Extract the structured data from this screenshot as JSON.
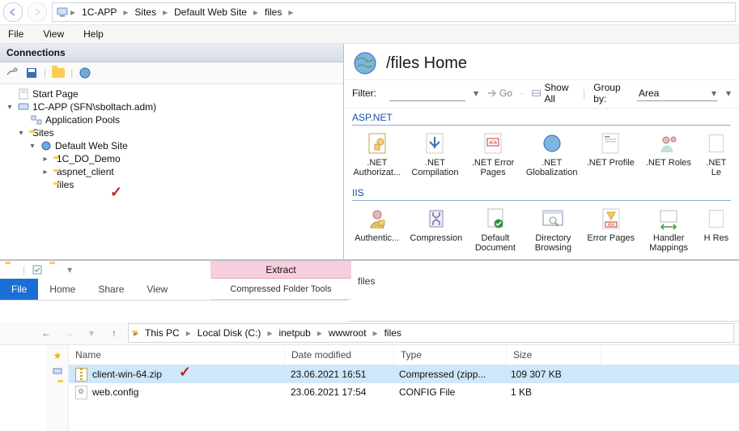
{
  "breadcrumb": {
    "root_icon": "server-icon",
    "items": [
      "1C-APP",
      "Sites",
      "Default Web Site",
      "files"
    ]
  },
  "menu": {
    "file": "File",
    "view": "View",
    "help": "Help"
  },
  "connections": {
    "title": "Connections",
    "tree": {
      "start_page": "Start Page",
      "server": "1C-APP (SFN\\sboltach.adm)",
      "app_pools": "Application Pools",
      "sites": "Sites",
      "default_site": "Default Web Site",
      "site_children": [
        "1C_DO_Demo",
        "aspnet_client",
        "files"
      ]
    }
  },
  "home": {
    "title": "/files Home",
    "filter_label": "Filter:",
    "go": "Go",
    "show_all": "Show All",
    "group_by": "Group by:",
    "group_value": "Area",
    "groups": {
      "aspnet": "ASP.NET",
      "iis": "IIS"
    },
    "aspnet_features": [
      ".NET Authorizat...",
      ".NET Compilation",
      ".NET Error Pages",
      ".NET Globalization",
      ".NET Profile",
      ".NET Roles",
      ".NET Le"
    ],
    "iis_features": [
      "Authentic...",
      "Compression",
      "Default Document",
      "Directory Browsing",
      "Error Pages",
      "Handler Mappings",
      "H Res"
    ]
  },
  "explorer": {
    "ribbon_extract": "Extract",
    "ribbon_tools": "Compressed Folder Tools",
    "ribbon": {
      "file": "File",
      "home": "Home",
      "share": "Share",
      "view": "View"
    },
    "addr_label": "files",
    "crumbs": [
      "This PC",
      "Local Disk (C:)",
      "inetpub",
      "wwwroot",
      "files"
    ],
    "columns": {
      "name": "Name",
      "date": "Date modified",
      "type": "Type",
      "size": "Size"
    },
    "rows": [
      {
        "name": "client-win-64.zip",
        "date": "23.06.2021 16:51",
        "type": "Compressed (zipp...",
        "size": "109 307 KB",
        "icon": "zip",
        "selected": true
      },
      {
        "name": "web.config",
        "date": "23.06.2021 17:54",
        "type": "CONFIG File",
        "size": "1 KB",
        "icon": "cfg",
        "selected": false
      }
    ]
  }
}
